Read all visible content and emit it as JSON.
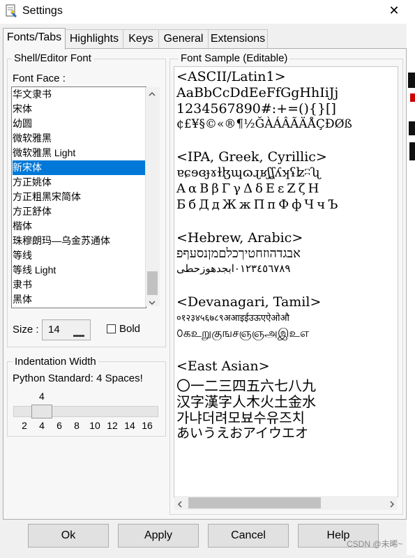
{
  "window": {
    "title": "Settings",
    "close_glyph": "✕"
  },
  "tabs": [
    {
      "label": "Fonts/Tabs",
      "active": true
    },
    {
      "label": "Highlights"
    },
    {
      "label": "Keys"
    },
    {
      "label": "General"
    },
    {
      "label": "Extensions"
    }
  ],
  "font_group": {
    "title": "Shell/Editor Font",
    "face_label": "Font Face :",
    "faces": [
      "华文隶书",
      "宋体",
      "幼圆",
      "微软雅黑",
      "微软雅黑 Light",
      "新宋体",
      "方正姚体",
      "方正粗黑宋简体",
      "方正舒体",
      "楷体",
      "珠穆朗玛—乌金苏通体",
      "等线",
      "等线 Light",
      "隶书",
      "黑体"
    ],
    "selected_index": 5,
    "size_label": "Size :",
    "size_value": "14",
    "bold_label": "Bold",
    "bold_checked": false
  },
  "indent_group": {
    "title": "Indentation Width",
    "description": "Python Standard: 4 Spaces!",
    "current_value": "4",
    "ticks": [
      "2",
      "4",
      "6",
      "8",
      "10",
      "12",
      "14",
      "16"
    ]
  },
  "sample": {
    "title": "Font Sample (Editable)",
    "lines": [
      "<ASCII/Latin1>",
      "AaBbCcDdEeFfGgHhIiJj",
      "1234567890#:+=(){}[]",
      "¢£¥§©«®¶½ĞÀÁÂÃÄÅÇÐØß",
      "",
      "<IPA, Greek, Cyrillic>",
      "ɐɕɘɞɟɤɫɮɰɷɻʁʃʆʎʞʢʫʭʯ",
      "ΑαΒβΓγΔδΕεΖζΗ",
      "БбДдЖжПпФфЧчЪ",
      "",
      "<Hebrew, Arabic>",
      "אבגדהוזחטיךכלםמןנסעףפ",
      "٠١٢٣٤٥٦٧٨٩ابجدهوزحطی",
      "",
      "<Devanagari, Tamil>",
      "०१२३४५६७८९अआइईउऊएऐओऔ",
      "௦கஉறுகுஙசஞஞஅஇஉஎ",
      "",
      "<East Asian>",
      "〇一二三四五六七八九",
      "汉字漢字人木火土金水",
      "가냐더려모뵤수유즈치",
      "あいうえおアイウエオ"
    ]
  },
  "buttons": {
    "ok": "Ok",
    "apply": "Apply",
    "cancel": "Cancel",
    "help": "Help"
  },
  "watermark": "CSDN @未晞~",
  "colors": {
    "selection": "#0078d7",
    "button_face": "#e1e1e1"
  }
}
